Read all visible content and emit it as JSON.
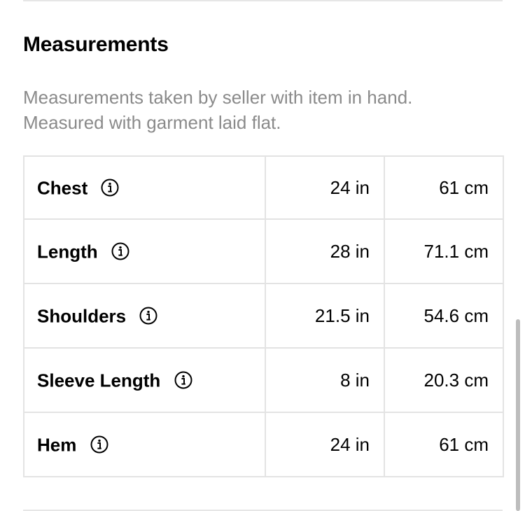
{
  "section": {
    "title": "Measurements",
    "description_lines": [
      "Measurements taken by seller with item in hand.",
      "Measured with garment laid flat."
    ]
  },
  "measurements": [
    {
      "label": "Chest",
      "inches": "24 in",
      "centimeters": "61 cm",
      "icon": "info-icon"
    },
    {
      "label": "Length",
      "inches": "28 in",
      "centimeters": "71.1 cm",
      "icon": "info-icon"
    },
    {
      "label": "Shoulders",
      "inches": "21.5 in",
      "centimeters": "54.6 cm",
      "icon": "info-icon"
    },
    {
      "label": "Sleeve Length",
      "inches": "8 in",
      "centimeters": "20.3 cm",
      "icon": "info-icon"
    },
    {
      "label": "Hem",
      "inches": "24 in",
      "centimeters": "61 cm",
      "icon": "info-icon"
    }
  ],
  "colors": {
    "text": "#000000",
    "muted_text": "#8a8a8a",
    "border": "#e3e3e3",
    "scrollbar": "#bdbdbd"
  }
}
